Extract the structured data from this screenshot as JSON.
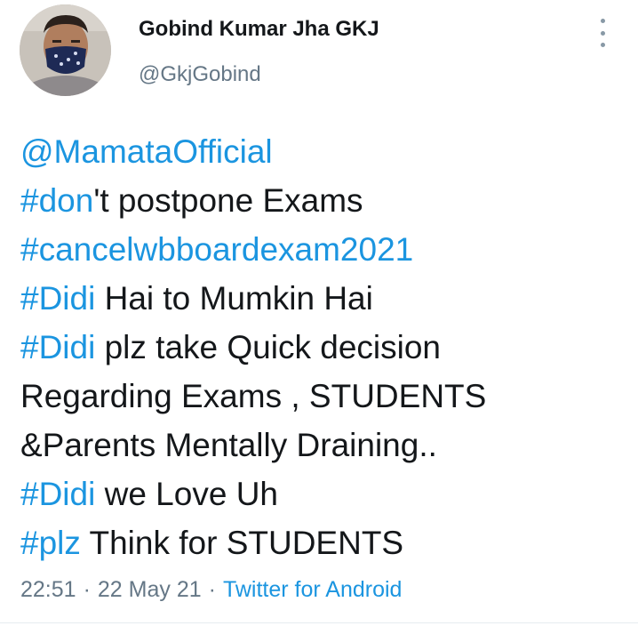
{
  "author": {
    "name": "Gobind Kumar Jha GKJ",
    "handle": "@GkjGobind"
  },
  "tweet": {
    "lines": [
      [
        {
          "text": "@MamataOfficial",
          "link": true
        }
      ],
      [
        {
          "text": "#don",
          "link": true
        },
        {
          "text": "'t postpone Exams",
          "link": false
        }
      ],
      [
        {
          "text": "#cancelwbboardexam2021",
          "link": true
        }
      ],
      [
        {
          "text": "#Didi",
          "link": true
        },
        {
          "text": " Hai to Mumkin Hai",
          "link": false
        }
      ],
      [
        {
          "text": "#Didi",
          "link": true
        },
        {
          "text": " plz take Quick decision",
          "link": false
        }
      ],
      [
        {
          "text": "Regarding Exams , STUDENTS",
          "link": false
        }
      ],
      [
        {
          "text": "&Parents Mentally Draining..",
          "link": false
        }
      ],
      [
        {
          "text": "#Didi",
          "link": true
        },
        {
          "text": " we Love Uh",
          "link": false
        }
      ],
      [
        {
          "text": "#plz",
          "link": true
        },
        {
          "text": " Think for STUDENTS",
          "link": false
        }
      ]
    ]
  },
  "meta": {
    "time": "22:51",
    "separator": "·",
    "date": "22 May 21",
    "source": "Twitter for Android"
  },
  "colors": {
    "link": "#1b95e0",
    "text": "#14171a",
    "secondary": "#657786"
  },
  "icons": {
    "more": "more-vertical-icon"
  }
}
